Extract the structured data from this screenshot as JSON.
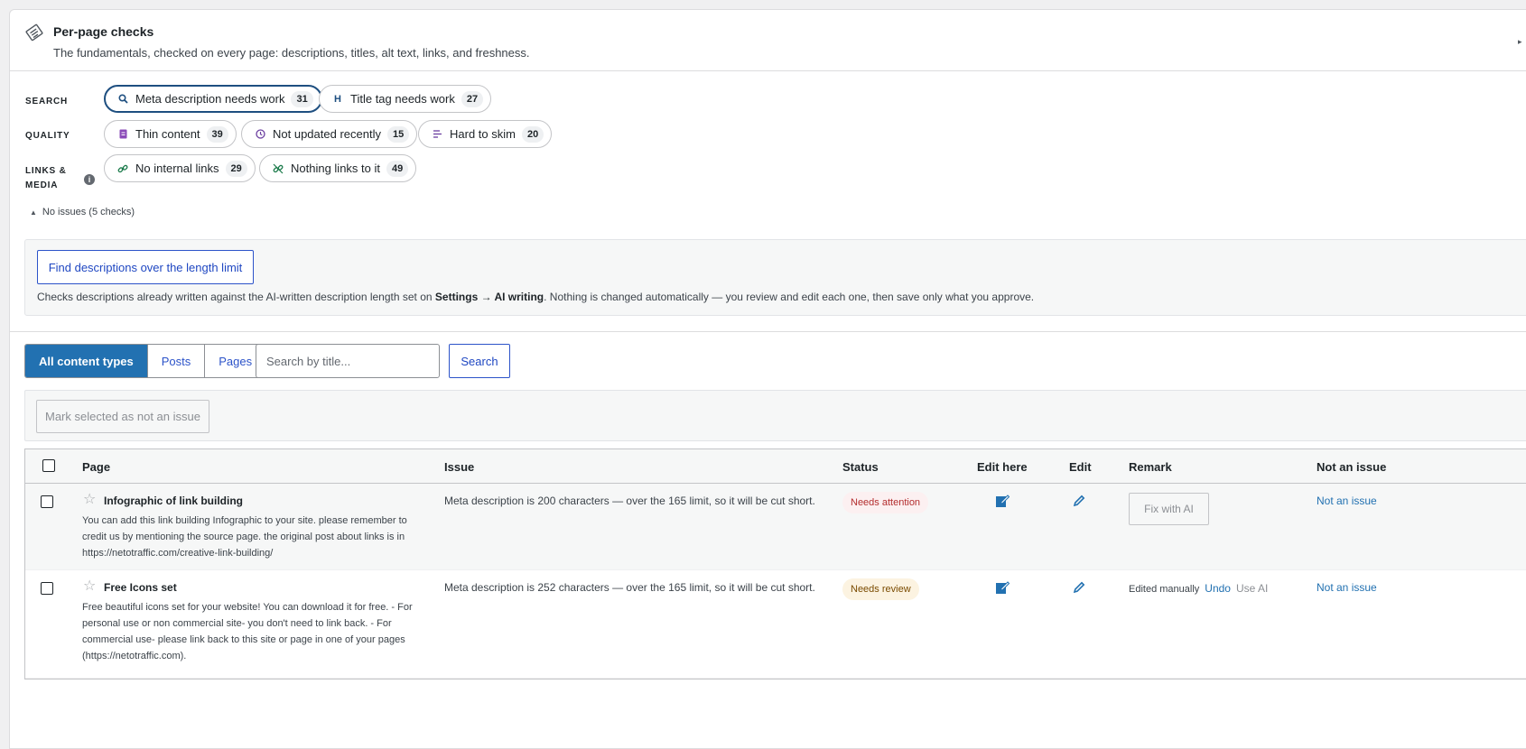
{
  "panel": {
    "title": "Per-page checks",
    "description": "The fundamentals, checked on every page: descriptions, titles, alt text, links, and freshness."
  },
  "groups": [
    {
      "label": "SEARCH",
      "chips": [
        {
          "label": "Meta description needs work",
          "count": "31",
          "icon": "search-icon",
          "active": true
        },
        {
          "label": "Title tag needs work",
          "count": "27",
          "icon": "heading-icon"
        }
      ]
    },
    {
      "label": "QUALITY",
      "chips": [
        {
          "label": "Thin content",
          "count": "39",
          "icon": "document-icon"
        },
        {
          "label": "Not updated recently",
          "count": "15",
          "icon": "clock-icon"
        },
        {
          "label": "Hard to skim",
          "count": "20",
          "icon": "text-lines-icon"
        }
      ]
    },
    {
      "label_line1": "LINKS &",
      "label_line2": "MEDIA",
      "chips": [
        {
          "label": "No internal links",
          "count": "29",
          "icon": "link-icon"
        },
        {
          "label": "Nothing links to it",
          "count": "49",
          "icon": "broken-link-icon"
        }
      ]
    }
  ],
  "no_issues": "No issues (5 checks)",
  "tool": {
    "button": "Find descriptions over the length limit",
    "note_before": "Checks descriptions already written against the AI-written description length set on ",
    "note_bold": "Settings → AI writing",
    "note_after": ". Nothing is changed automatically — you review and edit each one, then save only what you approve."
  },
  "filters": {
    "types": [
      "All content types",
      "Posts",
      "Pages"
    ],
    "search_placeholder": "Search by title...",
    "search_button": "Search"
  },
  "bulk": {
    "button": "Mark selected as not an issue"
  },
  "table": {
    "columns": {
      "page": "Page",
      "issue": "Issue",
      "status": "Status",
      "edit_here": "Edit here",
      "edit": "Edit",
      "remark": "Remark",
      "not_issue": "Not an issue"
    },
    "rows": [
      {
        "title": "Infographic of link building",
        "excerpt": "You can add this link building Infographic to your site. please remember to credit us by mentioning the source page. the original post about links is in https://netotraffic.com/creative-link-building/",
        "issue": "Meta description is 200 characters — over the 165 limit, so it will be cut short.",
        "status": "Needs attention",
        "remark_button": "Fix with AI",
        "not_issue": "Not an issue"
      },
      {
        "title": "Free Icons set",
        "excerpt": "Free beautiful icons set for your website! You can download it for free. - For personal use or non commercial site- you don't need to link back. - For commercial use- please link back to this site or page in one of your pages (https://netotraffic.com).",
        "issue": "Meta description is 252 characters — over the 165 limit, so it will be cut short.",
        "status": "Needs review",
        "remark_text": "Edited manually",
        "remark_undo": "Undo",
        "remark_useai": "Use AI",
        "not_issue": "Not an issue"
      }
    ]
  },
  "colors": {
    "accent": "#2271b1",
    "link": "#2c53c9",
    "active_chip_border": "#1e4f80",
    "attention": "#b32d2e",
    "review": "#7a4b00"
  }
}
